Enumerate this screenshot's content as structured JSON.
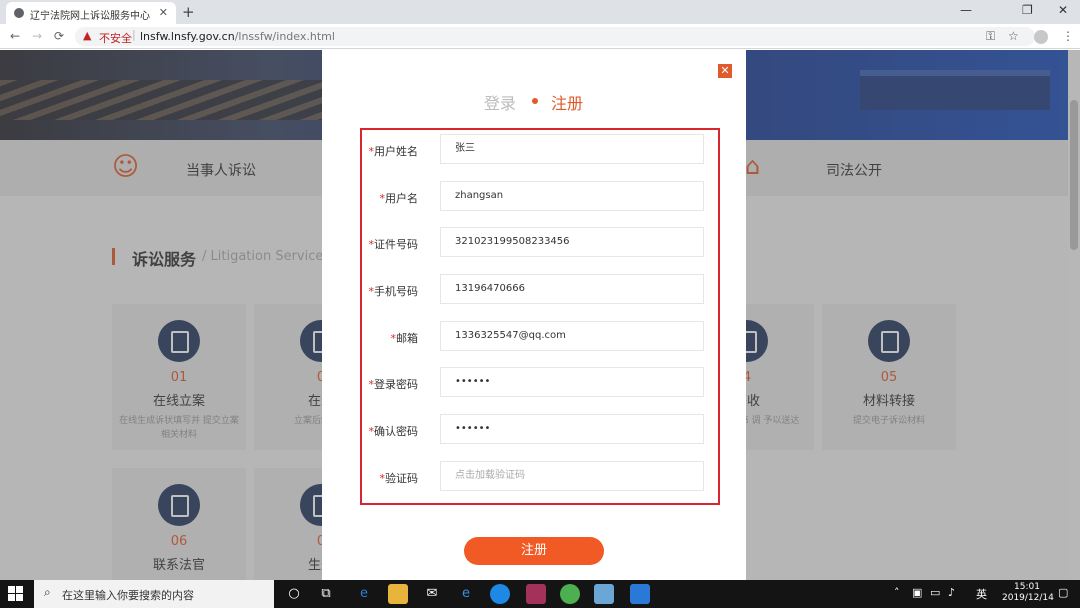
{
  "browser": {
    "tab_title": "辽宁法院网上诉讼服务中心",
    "new_tab": "+",
    "security_label": "不安全",
    "url_host": "lnsfw.lnsfy.gov.cn",
    "url_path": "/lnssfw/index.html",
    "win_controls": [
      "—",
      "❐",
      "✕"
    ]
  },
  "page": {
    "nav": [
      "当事人诉讼",
      "司法公开"
    ],
    "section_title": "诉讼服务",
    "section_subtitle": "/ Litigation Service",
    "cards": [
      {
        "num": "01",
        "name": "在线立案",
        "desc": "在线生成诉状填写并 提交立案相关材料"
      },
      {
        "num": "0",
        "name": "在线",
        "desc": "立案后缴纳费"
      },
      {
        "num": "4",
        "name": "签收",
        "desc": "书和其他文书 调 予以送达"
      },
      {
        "num": "05",
        "name": "材料转接",
        "desc": "提交电子诉讼材料"
      },
      {
        "num": "06",
        "name": "联系法官",
        "desc": ""
      },
      {
        "num": "0",
        "name": "生效",
        "desc": ""
      }
    ]
  },
  "modal": {
    "tab_login": "登录",
    "tab_register": "注册",
    "close": "✕",
    "fields": [
      {
        "label": "用户姓名",
        "value": "张三",
        "placeholder": ""
      },
      {
        "label": "用户名",
        "value": "zhangsan",
        "placeholder": ""
      },
      {
        "label": "证件号码",
        "value": "321023199508233456",
        "placeholder": ""
      },
      {
        "label": "手机号码",
        "value": "13196470666",
        "placeholder": ""
      },
      {
        "label": "邮箱",
        "value": "1336325547@qq.com",
        "placeholder": ""
      },
      {
        "label": "登录密码",
        "value": "••••••",
        "placeholder": ""
      },
      {
        "label": "确认密码",
        "value": "••••••",
        "placeholder": ""
      },
      {
        "label": "验证码",
        "value": "",
        "placeholder": "点击加载验证码"
      }
    ],
    "required_mark": "*",
    "submit_label": "注册"
  },
  "taskbar": {
    "search_placeholder": "在这里输入你要搜索的内容",
    "ime": "英",
    "time": "15:01",
    "date": "2019/12/14"
  }
}
